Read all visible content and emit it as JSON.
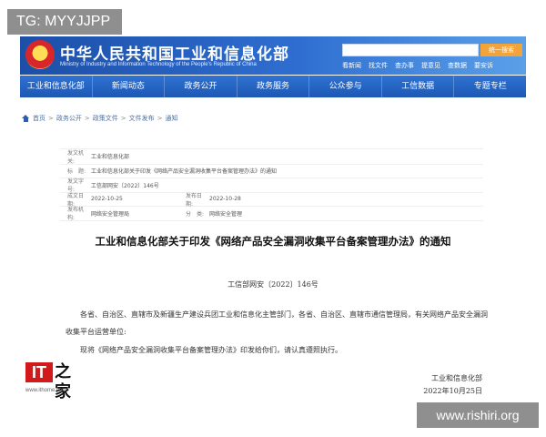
{
  "watermark_top": "TG: MYYJJPP",
  "watermark_bottom": "www.rishiri.org",
  "header": {
    "title": "中华人民共和国工业和信息化部",
    "subtitle": "Ministry of Industry and Information Technology of the People's Republic of China",
    "search_button": "统一搜索",
    "util_links": [
      "看新闻",
      "找文件",
      "查办事",
      "提意见",
      "查数据",
      "要安诉"
    ]
  },
  "nav": [
    "工业和信息化部",
    "新闻动态",
    "政务公开",
    "政务服务",
    "公众参与",
    "工信数据",
    "专题专栏"
  ],
  "breadcrumb": [
    "首页",
    "政务公开",
    "政策文件",
    "文件发布",
    "通知"
  ],
  "meta": {
    "issuer_label": "发文机关:",
    "issuer": "工业和信息化部",
    "title_label": "标　题:",
    "title": "工业和信息化部关于印发《网络产品安全漏洞收集平台备案管理办法》的通知",
    "num_label": "发文字号:",
    "num": "工信部网安〔2022〕146号",
    "created_label": "成文日期:",
    "created": "2022-10-25",
    "published_label": "发布日期:",
    "published": "2022-10-28",
    "org_label": "发布机构:",
    "org": "网络安全管理局",
    "cat_label": "分　类:",
    "cat": "网络安全管理"
  },
  "doc": {
    "title": "工业和信息化部关于印发《网络产品安全漏洞收集平台备案管理办法》的通知",
    "number": "工信部网安〔2022〕146号",
    "para1": "各省、自治区、直辖市及新疆生产建设兵团工业和信息化主管部门，各省、自治区、直辖市通信管理局，有关网络产品安全漏洞收集平台运营单位:",
    "para2": "现将《网络产品安全漏洞收集平台备案管理办法》印发给你们，请认真遵照执行。",
    "sign_org": "工业和信息化部",
    "sign_date": "2022年10月25日"
  },
  "logo": {
    "mark": "IT",
    "zh": "之家",
    "url": "www.ithome.com"
  }
}
